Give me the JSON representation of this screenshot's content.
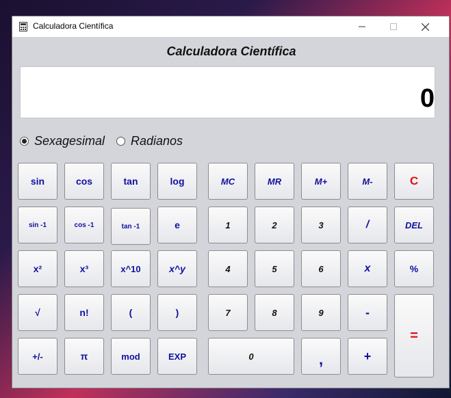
{
  "window": {
    "title": "Calculadora Científica",
    "icon": "calculator-icon",
    "controls": [
      "minimize",
      "maximize",
      "close"
    ]
  },
  "heading": "Calculadora Científica",
  "display": {
    "value": "0"
  },
  "angle_mode": {
    "options": [
      {
        "label": "Sexagesimal",
        "selected": true
      },
      {
        "label": "Radianos",
        "selected": false
      }
    ]
  },
  "buttons": {
    "sin": "sin",
    "cos": "cos",
    "tan": "tan",
    "log": "log",
    "asin": "sin -1",
    "acos": "cos -1",
    "atan": "tan -1",
    "e": "e",
    "sq": "x²",
    "cube": "x³",
    "pow10": "x^10",
    "powy": "x^y",
    "root": "√",
    "fact": "n!",
    "lparen": "(",
    "rparen": ")",
    "sign": "+/-",
    "pi": "π",
    "mod": "mod",
    "exp": "EXP",
    "mc": "MC",
    "mr": "MR",
    "mplus": "M+",
    "mminus": "M-",
    "clear": "C",
    "d1": "1",
    "d2": "2",
    "d3": "3",
    "div": "/",
    "del": "DEL",
    "d4": "4",
    "d5": "5",
    "d6": "6",
    "mul": "x",
    "pct": "%",
    "d7": "7",
    "d8": "8",
    "d9": "9",
    "sub": "-",
    "eq": "=",
    "d0": "0",
    "comma": ",",
    "add": "+"
  },
  "colors": {
    "key_text": "#1010a0",
    "accent_red": "#e01010",
    "window_bg": "#d4d5db"
  }
}
